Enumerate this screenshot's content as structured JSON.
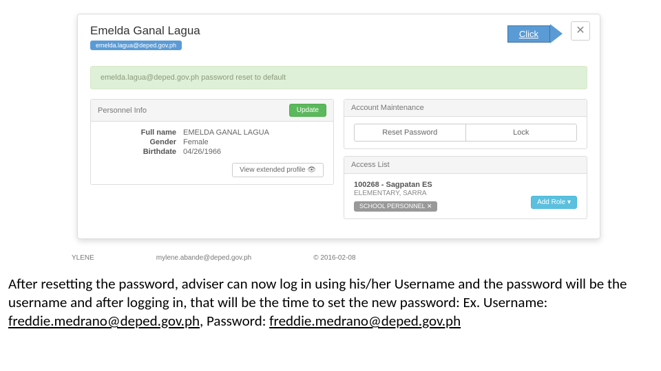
{
  "header": {
    "name": "Emelda Ganal Lagua",
    "email": "emelda.lagua@deped.gov.ph",
    "close": "✕",
    "click_label": "Click"
  },
  "alert": "emelda.lagua@deped.gov.ph password reset to default",
  "personnel": {
    "panel_title": "Personnel Info",
    "update": "Update",
    "labels": {
      "fullname": "Full name",
      "gender": "Gender",
      "birthdate": "Birthdate"
    },
    "values": {
      "fullname": "EMELDA GANAL LAGUA",
      "gender": "Female",
      "birthdate": "04/26/1966"
    },
    "extended": "View extended profile 👁"
  },
  "maintenance": {
    "panel_title": "Account Maintenance",
    "reset": "Reset Password",
    "lock": "Lock"
  },
  "access": {
    "panel_title": "Access List",
    "item_title": "100268 - Sagpatan ES",
    "item_sub": "ELEMENTARY, SARRA",
    "role": "SCHOOL PERSONNEL ✕",
    "add": "Add Role ▾"
  },
  "bg": {
    "name": "YLENE",
    "email": "mylene.abande@deped.gov.ph",
    "date": "© 2016-02-08"
  },
  "instruction": {
    "t1": "After resetting the password, adviser can now log in using his/her Username and the password will be the username and after logging in, that will be the time to set the new password: Ex. Username: ",
    "u1": "freddie.medrano@deped.gov.ph",
    "t2": ", Password: ",
    "u2": "freddie.medrano@deped.gov.ph"
  }
}
